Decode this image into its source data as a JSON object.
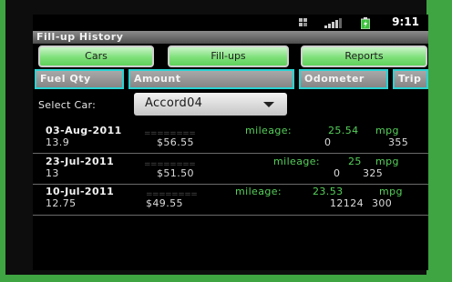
{
  "status_bar": {
    "time": "9:11",
    "icons": [
      "network-icon",
      "signal-icon",
      "battery-charging-icon"
    ]
  },
  "title": "Fill-up History",
  "nav": {
    "cars": "Cars",
    "fillups": "Fill-ups",
    "reports": "Reports"
  },
  "columns": {
    "fuel_qty": "Fuel Qty",
    "amount": "Amount",
    "odometer": "Odometer",
    "trip": "Trip"
  },
  "select_car": {
    "label": "Select Car:",
    "value": "Accord04"
  },
  "colors": {
    "mileage_green": "#55d05a",
    "button_green": "#7fe07a",
    "header_border": "#2bd3d3"
  },
  "entries": [
    {
      "date": "03-Aug-2011",
      "dashes": "========",
      "mileage_label": "mileage:",
      "mileage_value": "25.54",
      "mileage_unit": "mpg",
      "fuel_qty": "13.9",
      "amount": "$56.55",
      "odometer": "0",
      "trip": "355"
    },
    {
      "date": "23-Jul-2011",
      "dashes": "========",
      "mileage_label": "mileage:",
      "mileage_value": "25",
      "mileage_unit": "mpg",
      "fuel_qty": "13",
      "amount": "$51.50",
      "odometer": "0",
      "trip": "325"
    },
    {
      "date": "10-Jul-2011",
      "dashes": "========",
      "mileage_label": "mileage:",
      "mileage_value": "23.53",
      "mileage_unit": "mpg",
      "fuel_qty": "12.75",
      "amount": "$49.55",
      "odometer": "12124",
      "trip": "300"
    }
  ]
}
